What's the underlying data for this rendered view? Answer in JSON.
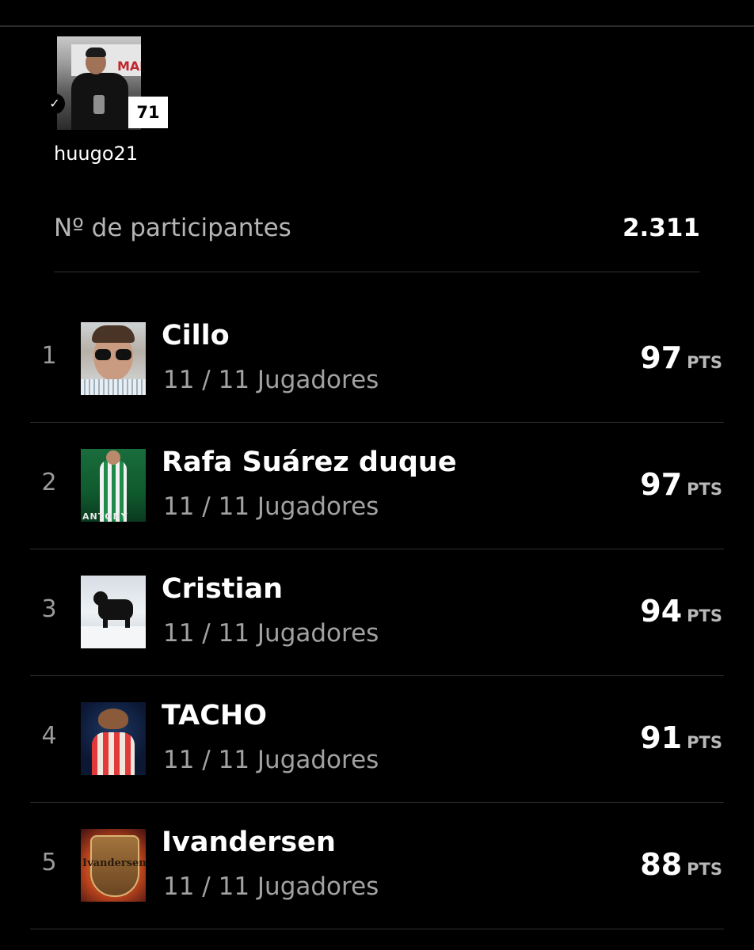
{
  "user": {
    "username": "huugo21",
    "level": "71",
    "verified_mark": "✓",
    "avatar_banner_text": "MAR"
  },
  "participants": {
    "label": "Nº de participantes",
    "value": "2.311"
  },
  "ranking": [
    {
      "position": "1",
      "name": "Cillo",
      "players": "11 / 11 Jugadores",
      "points": "97",
      "unit": "PTS"
    },
    {
      "position": "2",
      "name": "Rafa Suárez duque",
      "players": "11 / 11 Jugadores",
      "points": "97",
      "unit": "PTS",
      "avatar_text": "ANTONY"
    },
    {
      "position": "3",
      "name": "Cristian",
      "players": "11 / 11 Jugadores",
      "points": "94",
      "unit": "PTS"
    },
    {
      "position": "4",
      "name": "TACHO",
      "players": "11 / 11 Jugadores",
      "points": "91",
      "unit": "PTS"
    },
    {
      "position": "5",
      "name": "Ivandersen",
      "players": "11 / 11 Jugadores",
      "points": "88",
      "unit": "PTS",
      "avatar_text": "Ivandersen"
    }
  ],
  "colors": {
    "background": "#000000",
    "text_primary": "#ffffff",
    "text_secondary": "#a2a2a2",
    "divider": "#2e2e2e"
  }
}
